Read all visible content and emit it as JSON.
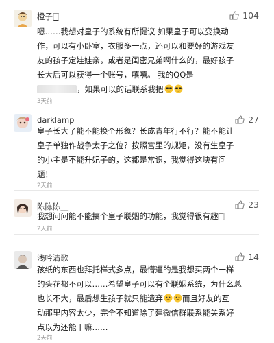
{
  "comments": [
    {
      "username": "橙子🀆",
      "likes": "104",
      "lines": [
        "嗯……我想对皇子的系统有所提议 如果皇子可以变换动",
        "作，可以有小卧室，衣服多一点，还可以和要好的游戏友",
        "友的孩子定娃娃亲，或者是闺密兄弟啊什么的，最好孩子",
        "长大后可以获得一个账号，嘻嘻。 我的QQ是"
      ],
      "line_end": "，如果可以的话联系我把",
      "time": "3天前"
    },
    {
      "username": "darklamp",
      "likes": "27",
      "lines": [
        "皇子长大了能不能换个形象？长成青年行不行？能不能让",
        "皇子单独作战争太子之位？按照宫里的规矩，没有生皇子",
        "的小主是不能升妃子的，这都是常识，我觉得这块有问",
        "题！"
      ],
      "time": "2天前"
    },
    {
      "username": "陈陈陈__",
      "likes": "23",
      "lines": [
        "我想问问能不能搞个皇子联姻的功能，我觉得很有趣🀆"
      ],
      "time": "2天前"
    },
    {
      "username": "浅吟清歌",
      "likes": "14",
      "lines": [
        "孩纸的东西也拜托样式多点，最懵逼的是我想买两个一样",
        "的头花都不可以……希望皇子可以有个联姻系统，为什么总",
        "也长不大，最后想生孩子就只能遗弃",
        "动那里内容太少，完全不知道除了建微信群联系能关系好",
        "点以为还能干嘛……"
      ],
      "line3_end": "而且好友的互",
      "time": "2天前"
    }
  ]
}
